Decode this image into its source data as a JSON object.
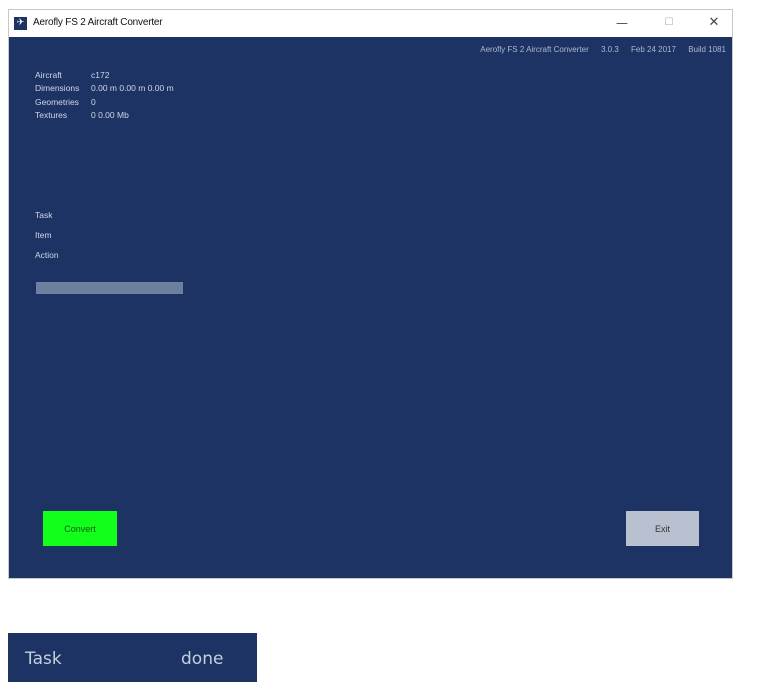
{
  "window": {
    "title": "Aerofly FS 2 Aircraft Converter",
    "icon": "app-icon",
    "controls": {
      "minimize": "—",
      "maximize": "☐",
      "close": "✕"
    }
  },
  "header_info": {
    "app_name": "Aerofly FS 2 Aircraft Converter",
    "version": "3.0.3",
    "date": "Feb 24 2017",
    "build": "Build 1081"
  },
  "aircraft_info": [
    {
      "label": "Aircraft",
      "value": "c172"
    },
    {
      "label": "Dimensions",
      "value": "0.00 m   0.00 m   0.00 m"
    },
    {
      "label": "Geometries",
      "value": "0"
    },
    {
      "label": "Textures",
      "value": "0   0.00 Mb"
    }
  ],
  "status": {
    "task_label": "Task",
    "item_label": "Item",
    "action_label": "Action"
  },
  "progress": {
    "fraction": 0
  },
  "buttons": {
    "convert": "Convert",
    "exit": "Exit"
  },
  "footer_panel": {
    "left": "Task",
    "right": "done"
  },
  "colors": {
    "background": "#1c3363",
    "convert_button": "#11ff1a",
    "exit_button": "#b9c0d0",
    "progress_track": "#6f7fa0"
  }
}
